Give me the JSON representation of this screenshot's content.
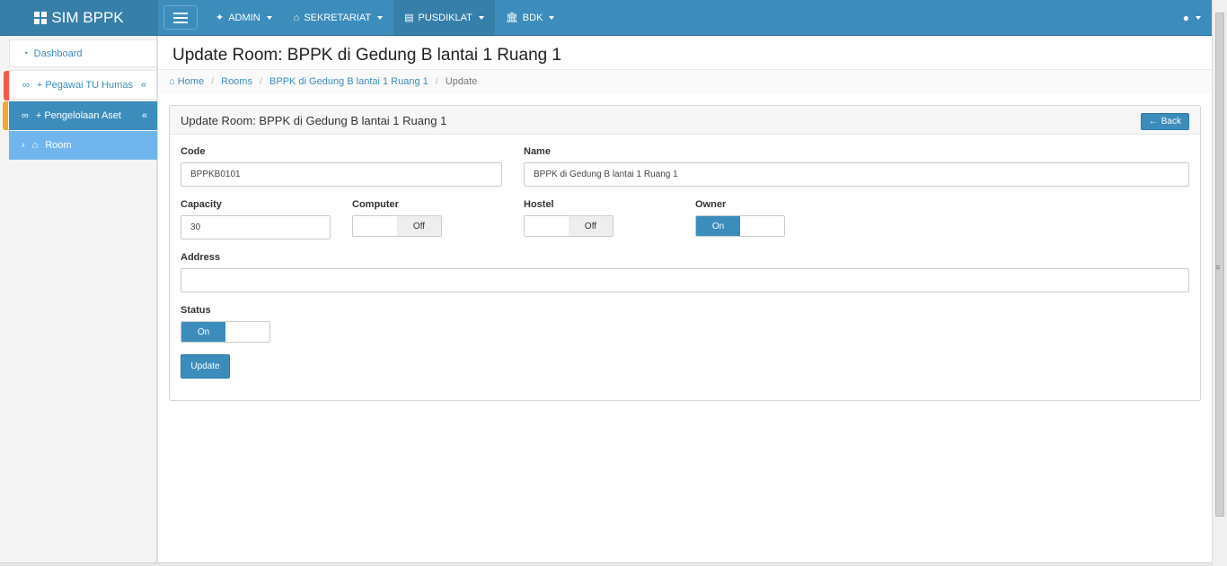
{
  "brand": {
    "title": "SIM BPPK"
  },
  "nav": {
    "items": [
      {
        "label": "ADMIN",
        "icon": "android-icon"
      },
      {
        "label": "SEKRETARIAT",
        "icon": "home-icon"
      },
      {
        "label": "PUSDIKLAT",
        "icon": "book-icon"
      },
      {
        "label": "BDK",
        "icon": "institution-icon"
      }
    ],
    "active": "PUSDIKLAT",
    "user_icon": "user-icon"
  },
  "sidebar": {
    "items": [
      {
        "label": "Dashboard",
        "icon": "dashboard-icon"
      },
      {
        "label": "+ Pegawai TU Humas",
        "icon": "link-icon",
        "arrow": "«"
      },
      {
        "label": "+ Pengelolaan Aset",
        "icon": "link-icon",
        "arrow": "«"
      },
      {
        "label": "Room",
        "icon": "bed-icon",
        "prefix": "›"
      }
    ]
  },
  "header": {
    "title": "Update Room: BPPK di Gedung B lantai 1 Ruang 1"
  },
  "breadcrumb": {
    "home": "Home",
    "rooms": "Rooms",
    "item": "BPPK di Gedung B lantai 1 Ruang 1",
    "current": "Update"
  },
  "box": {
    "title": "Update Room: BPPK di Gedung B lantai 1 Ruang 1",
    "back_label": "Back"
  },
  "form": {
    "code_label": "Code",
    "code_value": "BPPKB0101",
    "name_label": "Name",
    "name_value": "BPPK di Gedung B lantai 1 Ruang 1",
    "capacity_label": "Capacity",
    "capacity_value": "30",
    "computer_label": "Computer",
    "computer_state": "Off",
    "hostel_label": "Hostel",
    "hostel_state": "Off",
    "owner_label": "Owner",
    "owner_state": "On",
    "address_label": "Address",
    "address_value": "",
    "status_label": "Status",
    "status_state": "On",
    "update_label": "Update"
  },
  "colors": {
    "primary": "#3c8dbc",
    "primary_dark": "#367fa9",
    "accent_red": "#f05a4a",
    "accent_orange": "#f0a830",
    "room_active": "#71b5ee"
  }
}
